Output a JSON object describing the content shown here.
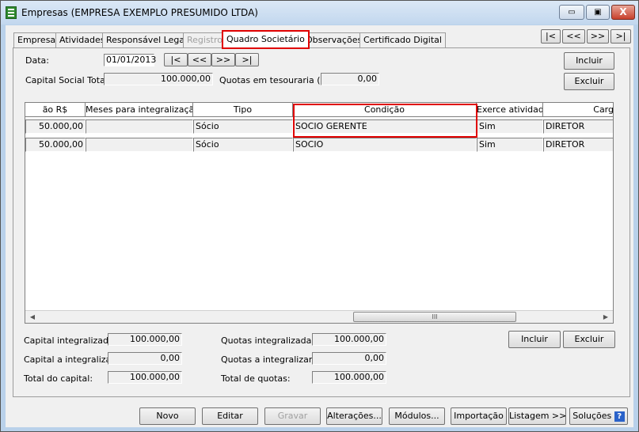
{
  "window": {
    "title": "Empresas (EMPRESA EXEMPLO PRESUMIDO LTDA)",
    "minimize_glyph": "▭",
    "maximize_glyph": "▣",
    "close_glyph": "X"
  },
  "tabs": [
    "Empresa",
    "Atividades",
    "Responsável Legal",
    "Registro",
    "Quadro Societário",
    "Observações",
    "Certificado Digital"
  ],
  "active_tab": "Quadro Societário",
  "nav": {
    "first": "|<",
    "prev": "<<",
    "next": ">>",
    "last": ">|"
  },
  "form": {
    "data_label": "Data:",
    "data_value": "01/01/2013",
    "capital_social_label": "Capital Social Total:",
    "capital_social_value": "100.000,00",
    "quotas_tesouraria_label": "Quotas em tesouraria (%):",
    "quotas_tesouraria_value": "0,00",
    "incluir": "Incluir",
    "excluir": "Excluir"
  },
  "grid": {
    "columns": [
      "ão R$",
      "Meses para integralização",
      "Tipo",
      "Condição",
      "Exerce atividade",
      "Carg"
    ],
    "rows": [
      [
        "50.000,00",
        "",
        "Sócio",
        "SOCIO GERENTE",
        "Sim",
        "DIRETOR"
      ],
      [
        "50.000,00",
        "",
        "Sócio",
        "SOCIO",
        "Sim",
        "DIRETOR"
      ]
    ],
    "scroll_left": "◀",
    "scroll_right": "▶",
    "scroll_grip": "III"
  },
  "totals": {
    "capital_integralizado_label": "Capital integralizado:",
    "capital_integralizado_value": "100.000,00",
    "capital_a_integralizar_label": "Capital a integralizar:",
    "capital_a_integralizar_value": "0,00",
    "total_capital_label": "Total do capital:",
    "total_capital_value": "100.000,00",
    "quotas_integralizadas_label": "Quotas integralizadas:",
    "quotas_integralizadas_value": "100.000,00",
    "quotas_a_integralizar_label": "Quotas a integralizar:",
    "quotas_a_integralizar_value": "0,00",
    "total_quotas_label": "Total de quotas:",
    "total_quotas_value": "100.000,00",
    "incluir": "Incluir",
    "excluir": "Excluir"
  },
  "bottom_bar": {
    "novo": "Novo",
    "editar": "Editar",
    "gravar": "Gravar",
    "alteracoes": "Alterações...",
    "modulos": "Módulos...",
    "importacao": "Importação",
    "listagem": "Listagem >>",
    "solucoes": "Soluções",
    "help_glyph": "?"
  },
  "colors": {
    "highlight": "#e00000",
    "window_frame": "#b9d1ea",
    "face": "#f0f0f0"
  }
}
